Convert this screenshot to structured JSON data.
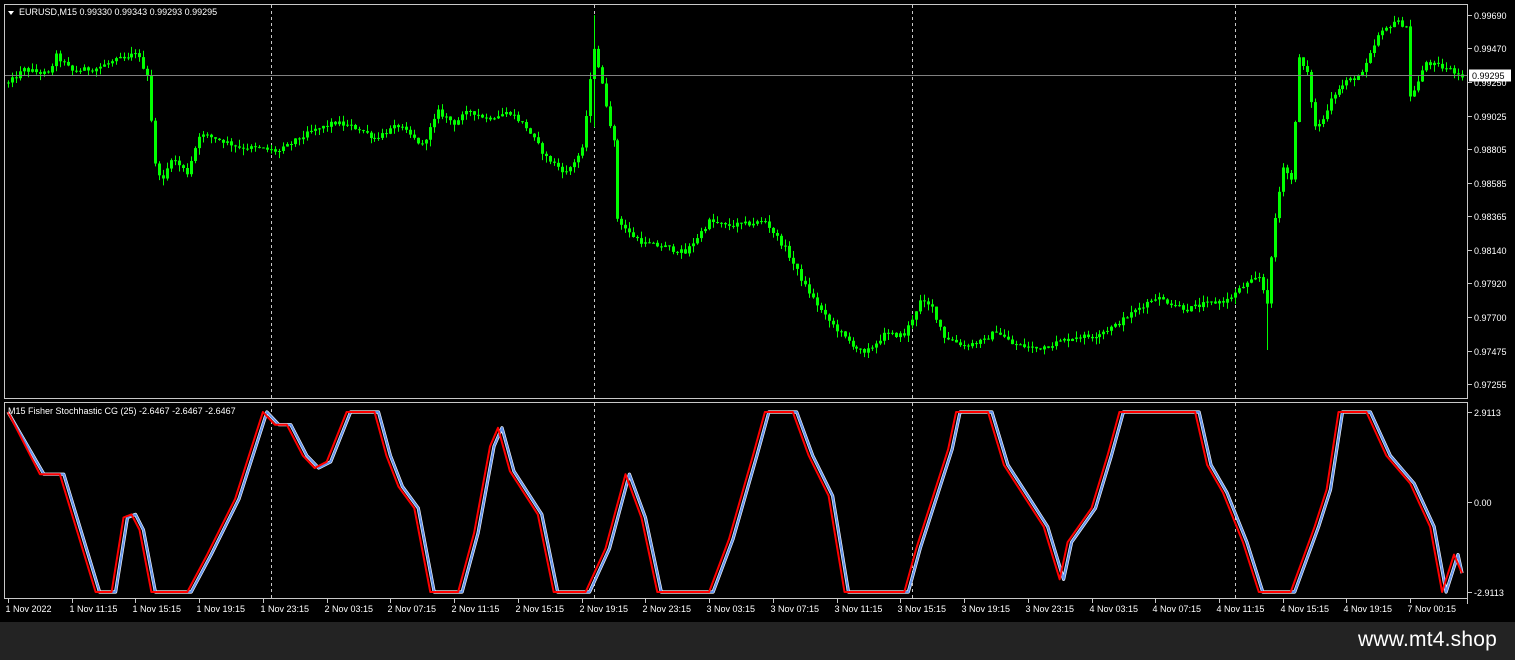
{
  "header": {
    "symbol_info": "EURUSD,M15  0.99330 0.99343 0.99293 0.99295",
    "indicator_info": "M15 Fisher Stochhastic CG (25) -2.6467 -2.6467 -2.6467"
  },
  "price_axis": {
    "labels": [
      "0.99690",
      "0.99470",
      "0.99250",
      "0.99025",
      "0.98805",
      "0.98585",
      "0.98365",
      "0.98140",
      "0.97920",
      "0.97700",
      "0.97475",
      "0.97255"
    ],
    "current_price": "0.99295",
    "ylim": [
      0.9717,
      0.9975
    ]
  },
  "indicator_axis": {
    "labels": [
      "2.9113",
      "0.00",
      "-2.9113"
    ],
    "ylim": [
      -2.9113,
      2.9113
    ]
  },
  "time_axis": {
    "labels": [
      "1 Nov 2022",
      "1 Nov 11:15",
      "1 Nov 15:15",
      "1 Nov 19:15",
      "1 Nov 23:15",
      "2 Nov 03:15",
      "2 Nov 07:15",
      "2 Nov 11:15",
      "2 Nov 15:15",
      "2 Nov 19:15",
      "2 Nov 23:15",
      "3 Nov 03:15",
      "3 Nov 07:15",
      "3 Nov 11:15",
      "3 Nov 15:15",
      "3 Nov 19:15",
      "3 Nov 23:15",
      "4 Nov 03:15",
      "4 Nov 07:15",
      "4 Nov 11:15",
      "4 Nov 15:15",
      "4 Nov 19:15",
      "7 Nov 00:15"
    ],
    "day_separators_bar_index": [
      66,
      147,
      227,
      308
    ]
  },
  "colors": {
    "background": "#000000",
    "candle": "#00ff00",
    "grid": "#c8c8c8",
    "price_line": "#808080",
    "fisher_main": "#ff0000",
    "fisher_signal": "#6495ed",
    "text": "#ffffff"
  },
  "footer": {
    "brand": "www.mt4.shop"
  },
  "chart_data": [
    {
      "type": "candlestick",
      "title": "EURUSD,M15",
      "bars": 366,
      "close_anchors": [
        [
          0,
          0.9924
        ],
        [
          4,
          0.9933
        ],
        [
          10,
          0.993
        ],
        [
          12,
          0.9942
        ],
        [
          16,
          0.9932
        ],
        [
          22,
          0.9934
        ],
        [
          28,
          0.994
        ],
        [
          30,
          0.994
        ],
        [
          32,
          0.9945
        ],
        [
          35,
          0.993
        ],
        [
          37,
          0.987
        ],
        [
          39,
          0.986
        ],
        [
          41,
          0.9875
        ],
        [
          45,
          0.9865
        ],
        [
          48,
          0.989
        ],
        [
          52,
          0.9888
        ],
        [
          58,
          0.9882
        ],
        [
          63,
          0.9881
        ],
        [
          68,
          0.9879
        ],
        [
          72,
          0.9886
        ],
        [
          76,
          0.9892
        ],
        [
          82,
          0.9898
        ],
        [
          88,
          0.9894
        ],
        [
          92,
          0.9888
        ],
        [
          98,
          0.9896
        ],
        [
          104,
          0.9883
        ],
        [
          108,
          0.9905
        ],
        [
          112,
          0.9898
        ],
        [
          116,
          0.9906
        ],
        [
          120,
          0.9901
        ],
        [
          126,
          0.9905
        ],
        [
          130,
          0.9895
        ],
        [
          135,
          0.9875
        ],
        [
          140,
          0.9865
        ],
        [
          144,
          0.988
        ],
        [
          147,
          0.9948
        ],
        [
          150,
          0.991
        ],
        [
          152,
          0.9885
        ],
        [
          153,
          0.9835
        ],
        [
          156,
          0.9825
        ],
        [
          160,
          0.9818
        ],
        [
          165,
          0.9816
        ],
        [
          170,
          0.9812
        ],
        [
          176,
          0.9833
        ],
        [
          180,
          0.983
        ],
        [
          185,
          0.9831
        ],
        [
          190,
          0.9833
        ],
        [
          195,
          0.9815
        ],
        [
          200,
          0.979
        ],
        [
          205,
          0.977
        ],
        [
          210,
          0.9756
        ],
        [
          215,
          0.9745
        ],
        [
          220,
          0.9758
        ],
        [
          225,
          0.9758
        ],
        [
          229,
          0.978
        ],
        [
          232,
          0.9776
        ],
        [
          235,
          0.9757
        ],
        [
          240,
          0.9751
        ],
        [
          245,
          0.9754
        ],
        [
          248,
          0.9761
        ],
        [
          252,
          0.9752
        ],
        [
          258,
          0.9749
        ],
        [
          262,
          0.9752
        ],
        [
          268,
          0.9757
        ],
        [
          272,
          0.9757
        ],
        [
          278,
          0.9764
        ],
        [
          284,
          0.9776
        ],
        [
          288,
          0.9783
        ],
        [
          292,
          0.9779
        ],
        [
          296,
          0.9775
        ],
        [
          300,
          0.9778
        ],
        [
          306,
          0.9781
        ],
        [
          310,
          0.979
        ],
        [
          314,
          0.9796
        ],
        [
          316,
          0.978
        ],
        [
          318,
          0.9835
        ],
        [
          320,
          0.987
        ],
        [
          322,
          0.986
        ],
        [
          324,
          0.994
        ],
        [
          326,
          0.993
        ],
        [
          328,
          0.9895
        ],
        [
          330,
          0.99
        ],
        [
          332,
          0.9915
        ],
        [
          336,
          0.9925
        ],
        [
          340,
          0.993
        ],
        [
          344,
          0.9955
        ],
        [
          348,
          0.9965
        ],
        [
          351,
          0.9962
        ],
        [
          352,
          0.9915
        ],
        [
          354,
          0.9925
        ],
        [
          356,
          0.9938
        ],
        [
          358,
          0.9936
        ],
        [
          362,
          0.9933
        ],
        [
          365,
          0.99295
        ]
      ],
      "ylim": [
        0.9717,
        0.9975
      ]
    },
    {
      "type": "line",
      "title": "M15 Fisher Stochhastic CG (25)",
      "x_range": [
        0,
        365
      ],
      "ylim": [
        -2.9113,
        2.9113
      ],
      "series": [
        {
          "name": "main",
          "values": [
            [
              0,
              2.91
            ],
            [
              8,
              0.9
            ],
            [
              13,
              0.9
            ],
            [
              22,
              -2.91
            ],
            [
              26,
              -2.91
            ],
            [
              29,
              -0.5
            ],
            [
              31,
              -0.4
            ],
            [
              33,
              -0.9
            ],
            [
              36,
              -2.91
            ],
            [
              45,
              -2.91
            ],
            [
              50,
              -1.7
            ],
            [
              57,
              0.1
            ],
            [
              64,
              2.91
            ],
            [
              67,
              2.5
            ],
            [
              70,
              2.5
            ],
            [
              74,
              1.5
            ],
            [
              77,
              1.1
            ],
            [
              80,
              1.3
            ],
            [
              85,
              2.91
            ],
            [
              92,
              2.91
            ],
            [
              95,
              1.5
            ],
            [
              98,
              0.5
            ],
            [
              102,
              -0.2
            ],
            [
              106,
              -2.91
            ],
            [
              113,
              -2.91
            ],
            [
              117,
              -1.0
            ],
            [
              121,
              1.8
            ],
            [
              123,
              2.4
            ],
            [
              126,
              1.0
            ],
            [
              133,
              -0.4
            ],
            [
              137,
              -2.91
            ],
            [
              145,
              -2.91
            ],
            [
              150,
              -1.5
            ],
            [
              155,
              0.9
            ],
            [
              159,
              -0.5
            ],
            [
              163,
              -2.91
            ],
            [
              176,
              -2.91
            ],
            [
              181,
              -1.2
            ],
            [
              187,
              1.5
            ],
            [
              190,
              2.91
            ],
            [
              197,
              2.91
            ],
            [
              201,
              1.5
            ],
            [
              206,
              0.2
            ],
            [
              210,
              -2.91
            ],
            [
              225,
              -2.91
            ],
            [
              228,
              -1.5
            ],
            [
              236,
              1.7
            ],
            [
              238,
              2.91
            ],
            [
              246,
              2.91
            ],
            [
              250,
              1.2
            ],
            [
              255,
              0.2
            ],
            [
              260,
              -0.8
            ],
            [
              264,
              -2.5
            ],
            [
              266,
              -1.3
            ],
            [
              272,
              -0.2
            ],
            [
              276,
              1.5
            ],
            [
              279,
              2.91
            ],
            [
              298,
              2.91
            ],
            [
              301,
              1.2
            ],
            [
              305,
              0.3
            ],
            [
              310,
              -1.3
            ],
            [
              314,
              -2.91
            ],
            [
              322,
              -2.91
            ],
            [
              328,
              -0.8
            ],
            [
              331,
              0.4
            ],
            [
              334,
              2.91
            ],
            [
              341,
              2.91
            ],
            [
              346,
              1.5
            ],
            [
              352,
              0.6
            ],
            [
              357,
              -0.8
            ],
            [
              360,
              -2.91
            ],
            [
              363,
              -1.7
            ],
            [
              365,
              -2.3
            ]
          ]
        },
        {
          "name": "signal",
          "values": [
            [
              0,
              2.91
            ],
            [
              9,
              0.9
            ],
            [
              14,
              0.9
            ],
            [
              23,
              -2.91
            ],
            [
              27,
              -2.91
            ],
            [
              30,
              -0.5
            ],
            [
              32,
              -0.4
            ],
            [
              34,
              -0.9
            ],
            [
              37,
              -2.91
            ],
            [
              46,
              -2.91
            ],
            [
              51,
              -1.7
            ],
            [
              58,
              0.1
            ],
            [
              65,
              2.91
            ],
            [
              68,
              2.5
            ],
            [
              71,
              2.5
            ],
            [
              75,
              1.5
            ],
            [
              78,
              1.1
            ],
            [
              81,
              1.3
            ],
            [
              86,
              2.91
            ],
            [
              93,
              2.91
            ],
            [
              96,
              1.5
            ],
            [
              99,
              0.5
            ],
            [
              103,
              -0.2
            ],
            [
              107,
              -2.91
            ],
            [
              114,
              -2.91
            ],
            [
              118,
              -1.0
            ],
            [
              122,
              1.8
            ],
            [
              124,
              2.4
            ],
            [
              127,
              1.0
            ],
            [
              134,
              -0.4
            ],
            [
              138,
              -2.91
            ],
            [
              146,
              -2.91
            ],
            [
              151,
              -1.5
            ],
            [
              156,
              0.9
            ],
            [
              160,
              -0.5
            ],
            [
              164,
              -2.91
            ],
            [
              177,
              -2.91
            ],
            [
              182,
              -1.2
            ],
            [
              188,
              1.5
            ],
            [
              191,
              2.91
            ],
            [
              198,
              2.91
            ],
            [
              202,
              1.5
            ],
            [
              207,
              0.2
            ],
            [
              211,
              -2.91
            ],
            [
              226,
              -2.91
            ],
            [
              229,
              -1.5
            ],
            [
              237,
              1.7
            ],
            [
              239,
              2.91
            ],
            [
              247,
              2.91
            ],
            [
              251,
              1.2
            ],
            [
              256,
              0.2
            ],
            [
              261,
              -0.8
            ],
            [
              265,
              -2.5
            ],
            [
              267,
              -1.3
            ],
            [
              273,
              -0.2
            ],
            [
              277,
              1.5
            ],
            [
              280,
              2.91
            ],
            [
              299,
              2.91
            ],
            [
              302,
              1.2
            ],
            [
              306,
              0.3
            ],
            [
              311,
              -1.3
            ],
            [
              315,
              -2.91
            ],
            [
              323,
              -2.91
            ],
            [
              329,
              -0.8
            ],
            [
              332,
              0.4
            ],
            [
              335,
              2.91
            ],
            [
              342,
              2.91
            ],
            [
              347,
              1.5
            ],
            [
              353,
              0.6
            ],
            [
              358,
              -0.8
            ],
            [
              361,
              -2.91
            ],
            [
              364,
              -1.7
            ],
            [
              365,
              -2.3
            ]
          ]
        }
      ]
    }
  ]
}
